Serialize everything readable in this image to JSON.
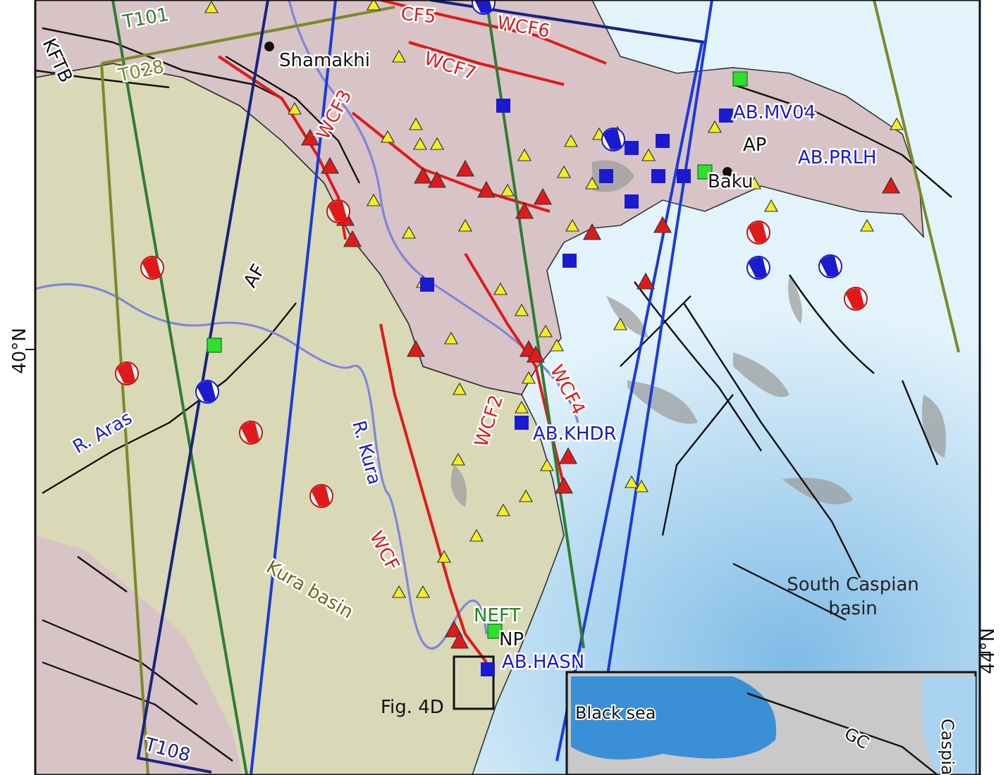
{
  "map": {
    "profile_labels": [
      {
        "label": "T101",
        "color": "#2e7d32"
      },
      {
        "label": "T028",
        "color": "#7a8a2a"
      },
      {
        "label": "T108",
        "color": "#1a237e"
      }
    ],
    "structure_labels": [
      "KFTB",
      "AF"
    ],
    "place_labels": [
      "Shamakhi",
      "AP",
      "Baku",
      "NP"
    ],
    "fault_labels": [
      "CF5",
      "WCF6",
      "WCF7",
      "WCF3",
      "WCF4",
      "WCF2",
      "WCF"
    ],
    "station_labels": [
      {
        "label": "AB.MV04",
        "color": "#1a1ad0"
      },
      {
        "label": "AB.PRLH",
        "color": "#1a1ad0"
      },
      {
        "label": "AB.KHDR",
        "color": "#1a1ad0"
      },
      {
        "label": "NEFT",
        "color": "#1e8c1e"
      },
      {
        "label": "AB.HASN",
        "color": "#1a1ad0"
      }
    ],
    "river_labels": [
      "R. Aras",
      "R. Kura"
    ],
    "basin_labels": [
      {
        "label": "Kura basin",
        "color": "#6b6b1e"
      },
      {
        "label": "South Caspian basin",
        "color": "#222222"
      }
    ],
    "latitude_ticks": [
      "40°N",
      "44°N"
    ],
    "figure_box_label": "Fig. 4D",
    "inset": {
      "labels": [
        "Black sea",
        "GC",
        "Caspia"
      ]
    }
  }
}
